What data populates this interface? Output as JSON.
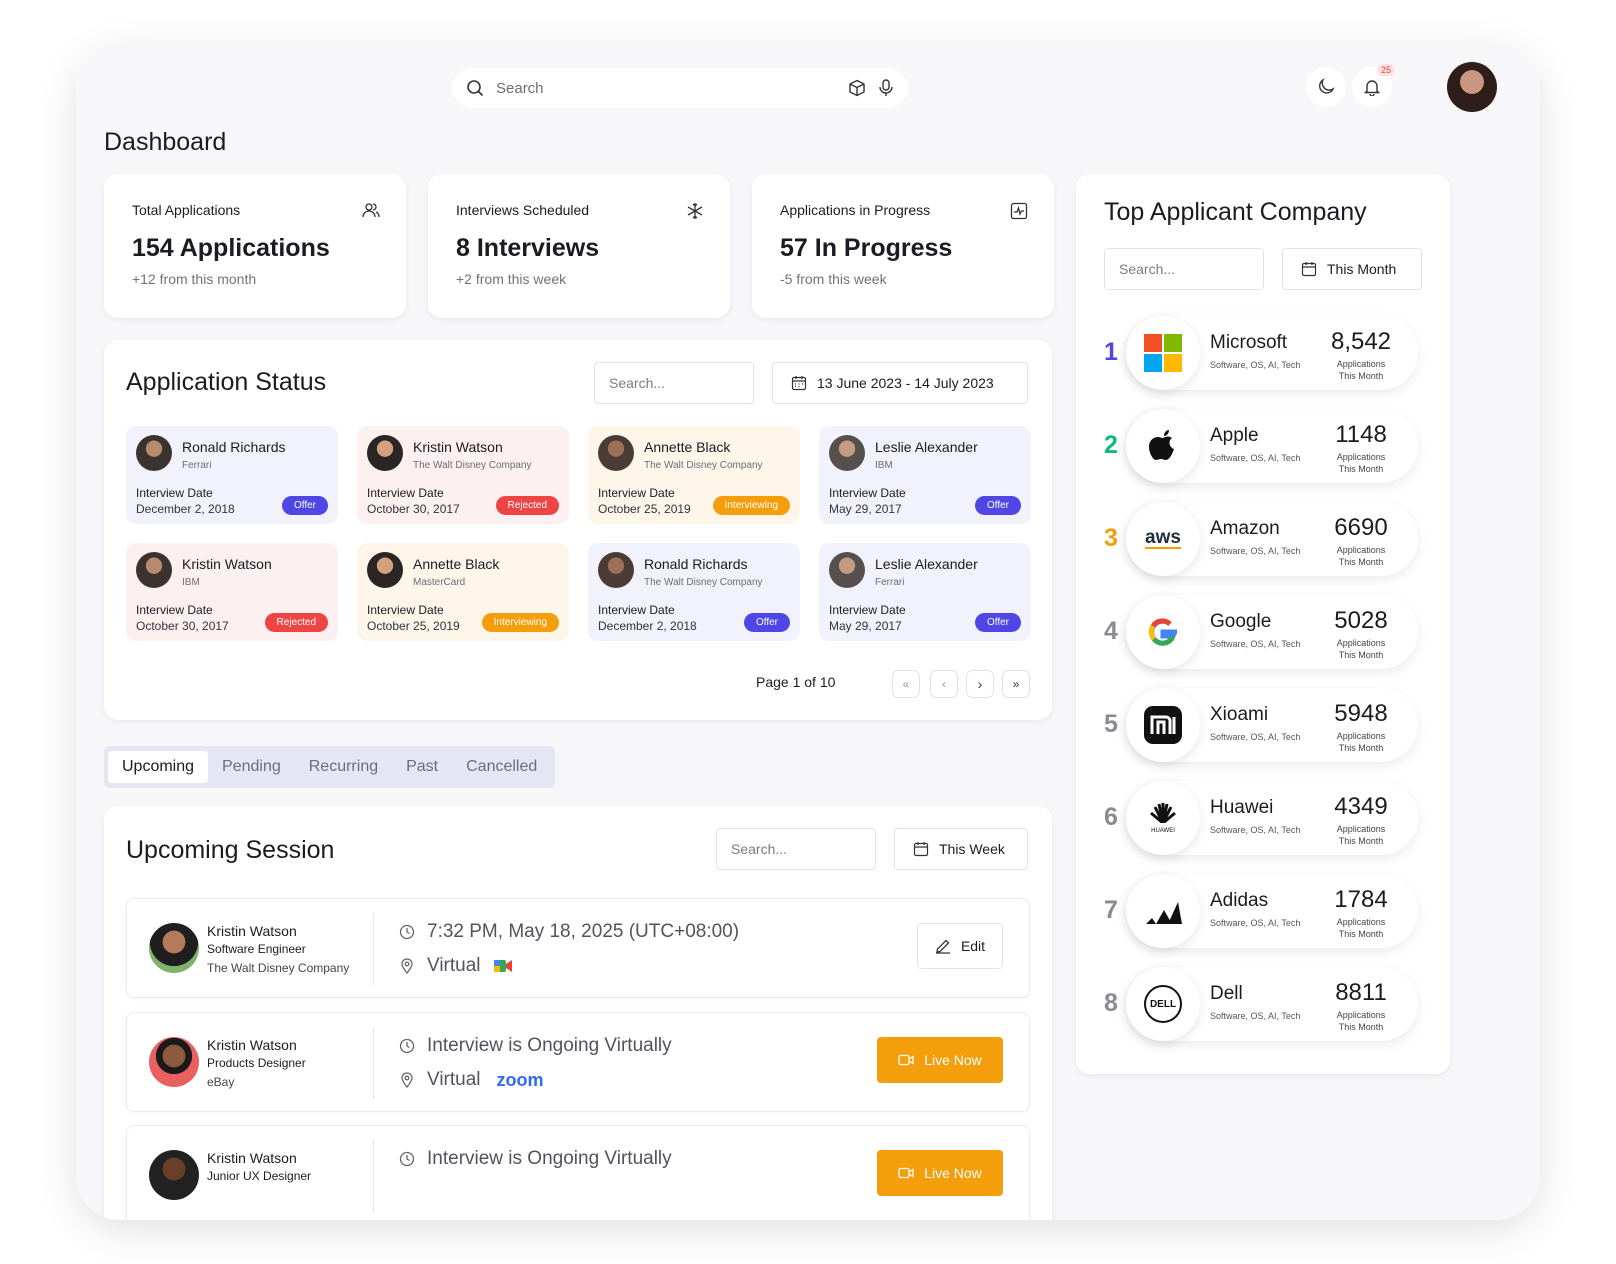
{
  "search": {
    "placeholder": "Search"
  },
  "notifications": {
    "count": "25"
  },
  "page_title": "Dashboard",
  "stats": [
    {
      "label": "Total Applications",
      "value": "154 Applications",
      "sub": "+12 from this month",
      "icon": "users-icon"
    },
    {
      "label": "Interviews Scheduled",
      "value": "8 Interviews",
      "sub": "+2 from this week",
      "icon": "snowflake-icon"
    },
    {
      "label": "Applications in Progress",
      "value": "57 In Progress",
      "sub": "-5 from this week",
      "icon": "activity-icon"
    }
  ],
  "application_status": {
    "title": "Application Status",
    "search_placeholder": "Search...",
    "date_range": "13 June 2023 - 14 July 2023",
    "date_label": "Interview Date",
    "cards": [
      {
        "name": "Ronald Richards",
        "company": "Ferrari",
        "date": "December 2, 2018",
        "status": "Offer"
      },
      {
        "name": "Kristin Watson",
        "company": "The Walt Disney Company",
        "date": "October 30, 2017",
        "status": "Rejected"
      },
      {
        "name": "Annette Black",
        "company": "The Walt Disney Company",
        "date": "October 25, 2019",
        "status": "Interviewing"
      },
      {
        "name": "Leslie Alexander",
        "company": "IBM",
        "date": "May 29, 2017",
        "status": "Offer"
      },
      {
        "name": "Kristin Watson",
        "company": "IBM",
        "date": "October 30, 2017",
        "status": "Rejected"
      },
      {
        "name": "Annette Black",
        "company": "MasterCard",
        "date": "October 25, 2019",
        "status": "Interviewing"
      },
      {
        "name": "Ronald Richards",
        "company": "The Walt Disney Company",
        "date": "December 2, 2018",
        "status": "Offer"
      },
      {
        "name": "Leslie Alexander",
        "company": "Ferrari",
        "date": "May 29, 2017",
        "status": "Offer"
      }
    ],
    "pagination": "Page 1 of 10"
  },
  "status_colors": {
    "Offer": "#4f46e5",
    "Rejected": "#ef4444",
    "Interviewing": "#f59e0b"
  },
  "card_backgrounds": {
    "Offer": "#f2f2fc",
    "Rejected": "#fdf0f1",
    "Interviewing": "#fff6ea"
  },
  "tabs": [
    "Upcoming",
    "Pending",
    "Recurring",
    "Past",
    "Cancelled"
  ],
  "upcoming": {
    "title": "Upcoming Session",
    "search_placeholder": "Search...",
    "range": "This Week",
    "sessions": [
      {
        "name": "Kristin Watson",
        "role": "Software Engineer",
        "company": "The Walt Disney Company",
        "time": "7:32 PM, May 18, 2025 (UTC+08:00)",
        "location": "Virtual",
        "platform": "google-meet-icon",
        "action": "Edit"
      },
      {
        "name": "Kristin Watson",
        "role": "Products Designer",
        "company": "eBay",
        "time": "Interview is Ongoing Virtually",
        "location": "Virtual",
        "platform": "zoom",
        "platform_text": "zoom",
        "action": "Live Now"
      },
      {
        "name": "Kristin Watson",
        "role": "Junior UX Designer",
        "company": "",
        "time": "Interview is Ongoing Virtually",
        "location": "",
        "platform": "",
        "action": "Live Now"
      }
    ]
  },
  "top_companies": {
    "title": "Top Applicant Company",
    "search_placeholder": "Search...",
    "range": "This Month",
    "caption_line1": "Applications",
    "caption_line2": "This Month",
    "items": [
      {
        "rank": "1",
        "name": "Microsoft",
        "tags": "Software, OS, AI, Tech",
        "count": "8,542",
        "rank_color": "#4f46e5",
        "logo": "microsoft-logo-icon"
      },
      {
        "rank": "2",
        "name": "Apple",
        "tags": "Software, OS, AI, Tech",
        "count": "1148",
        "rank_color": "#10b981",
        "logo": "apple-logo-icon"
      },
      {
        "rank": "3",
        "name": "Amazon",
        "tags": "Software, OS, AI, Tech",
        "count": "6690",
        "rank_color": "#f59e0b",
        "logo": "aws-logo-icon",
        "logo_text": "aws"
      },
      {
        "rank": "4",
        "name": "Google",
        "tags": "Software, OS, AI, Tech",
        "count": "5028",
        "rank_color": "#8a8a93",
        "logo": "google-logo-icon"
      },
      {
        "rank": "5",
        "name": "Xioami",
        "tags": "Software, OS, AI, Tech",
        "count": "5948",
        "rank_color": "#8a8a93",
        "logo": "xiaomi-logo-icon"
      },
      {
        "rank": "6",
        "name": "Huawei",
        "tags": "Software, OS, AI, Tech",
        "count": "4349",
        "rank_color": "#8a8a93",
        "logo": "huawei-logo-icon",
        "logo_text": "HUAWEI"
      },
      {
        "rank": "7",
        "name": "Adidas",
        "tags": "Software, OS, AI, Tech",
        "count": "1784",
        "rank_color": "#8a8a93",
        "logo": "adidas-logo-icon"
      },
      {
        "rank": "8",
        "name": "Dell",
        "tags": "Software, OS, AI, Tech",
        "count": "8811",
        "rank_color": "#8a8a93",
        "logo": "dell-logo-icon",
        "logo_text": "DELL"
      }
    ]
  }
}
